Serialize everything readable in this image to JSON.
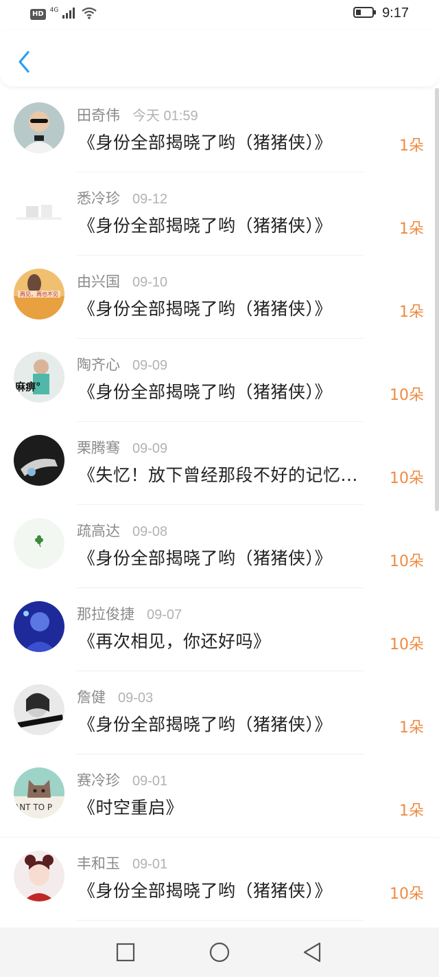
{
  "status_bar": {
    "left": "HD",
    "network": "4G",
    "time": "9:17"
  },
  "icons": {
    "back": "chevron-left-icon",
    "signal": "signal-icon",
    "wifi": "wifi-icon",
    "battery": "battery-icon"
  },
  "accent": "#2a9df4",
  "count_color": "#f08a40",
  "items": [
    {
      "name": "田奇伟",
      "date": "今天 01:59",
      "title": "《身份全部揭晓了哟（猪猪侠）》",
      "count": "1朵"
    },
    {
      "name": "悉冷珍",
      "date": "09-12",
      "title": "《身份全部揭晓了哟（猪猪侠）》",
      "count": "1朵"
    },
    {
      "name": "由兴国",
      "date": "09-10",
      "title": "《身份全部揭晓了哟（猪猪侠）》",
      "count": "1朵"
    },
    {
      "name": "陶齐心",
      "date": "09-09",
      "title": "《身份全部揭晓了哟（猪猪侠）》",
      "count": "10朵"
    },
    {
      "name": "栗腾骞",
      "date": "09-09",
      "title": "《失忆！放下曾经那段不好的记忆...",
      "count": "10朵"
    },
    {
      "name": "疏高达",
      "date": "09-08",
      "title": "《身份全部揭晓了哟（猪猪侠）》",
      "count": "10朵"
    },
    {
      "name": "那拉俊捷",
      "date": "09-07",
      "title": "《再次相见，你还好吗》",
      "count": "10朵"
    },
    {
      "name": "詹健",
      "date": "09-03",
      "title": "《身份全部揭晓了哟（猪猪侠）》",
      "count": "1朵"
    },
    {
      "name": "赛冷珍",
      "date": "09-01",
      "title": "《时空重启》",
      "count": "1朵"
    },
    {
      "name": "丰和玉",
      "date": "09-01",
      "title": "《身份全部揭晓了哟（猪猪侠）》",
      "count": "10朵"
    }
  ],
  "nav": {
    "recent": "square-icon",
    "home": "circle-icon",
    "back": "triangle-back-icon"
  }
}
